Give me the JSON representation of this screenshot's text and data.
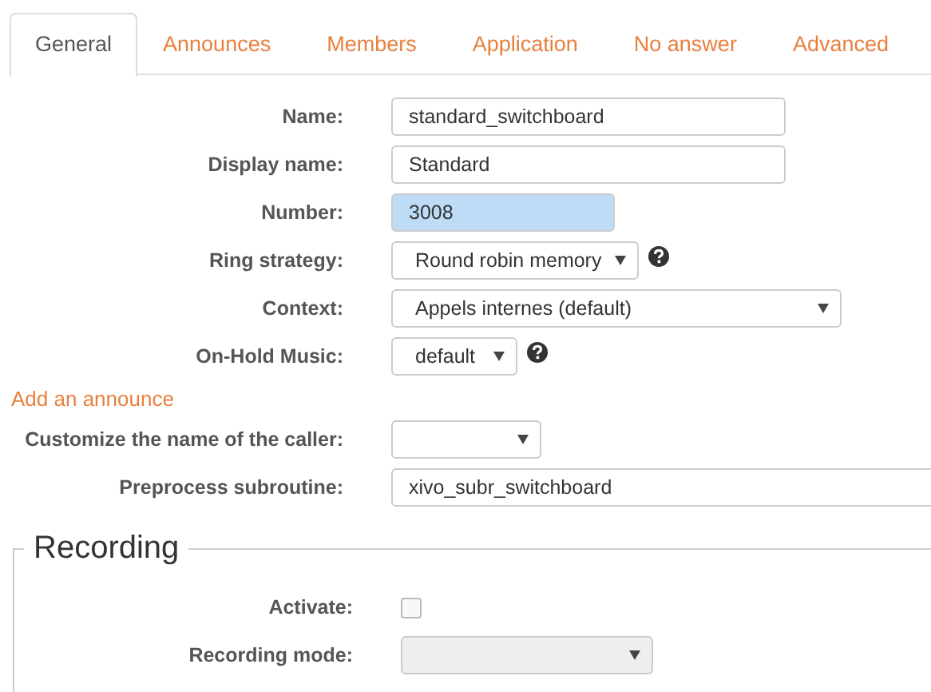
{
  "tabs": [
    {
      "label": "General",
      "selected": true
    },
    {
      "label": "Announces",
      "selected": false
    },
    {
      "label": "Members",
      "selected": false
    },
    {
      "label": "Application",
      "selected": false
    },
    {
      "label": "No answer",
      "selected": false
    },
    {
      "label": "Advanced",
      "selected": false
    }
  ],
  "fields": [
    {
      "kind": "text",
      "label": "Name:",
      "value": "standard_switchboard",
      "focused": false
    },
    {
      "kind": "text",
      "label": "Display name:",
      "value": "Standard",
      "focused": false
    },
    {
      "kind": "text",
      "label": "Number:",
      "value": "3008",
      "focused": true
    },
    {
      "kind": "select",
      "label": "Ring strategy:",
      "value": "Round robin memory",
      "help": true
    },
    {
      "kind": "select",
      "label": "Context:",
      "value": "Appels internes (default)",
      "help": false
    },
    {
      "kind": "select",
      "label": "On-Hold Music:",
      "value": "default",
      "help": true
    },
    {
      "kind": "link",
      "label": "Add an announce"
    },
    {
      "kind": "select",
      "label": "Customize the name of the caller:",
      "help": false
    },
    {
      "kind": "text",
      "label": "Preprocess subroutine:",
      "value": "xivo_subr_switchboard",
      "focused": false
    }
  ],
  "recording": {
    "title": "Recording",
    "activate": {
      "label": "Activate:",
      "checked": false
    },
    "mode": {
      "label": "Recording mode:",
      "disabled": true
    }
  }
}
